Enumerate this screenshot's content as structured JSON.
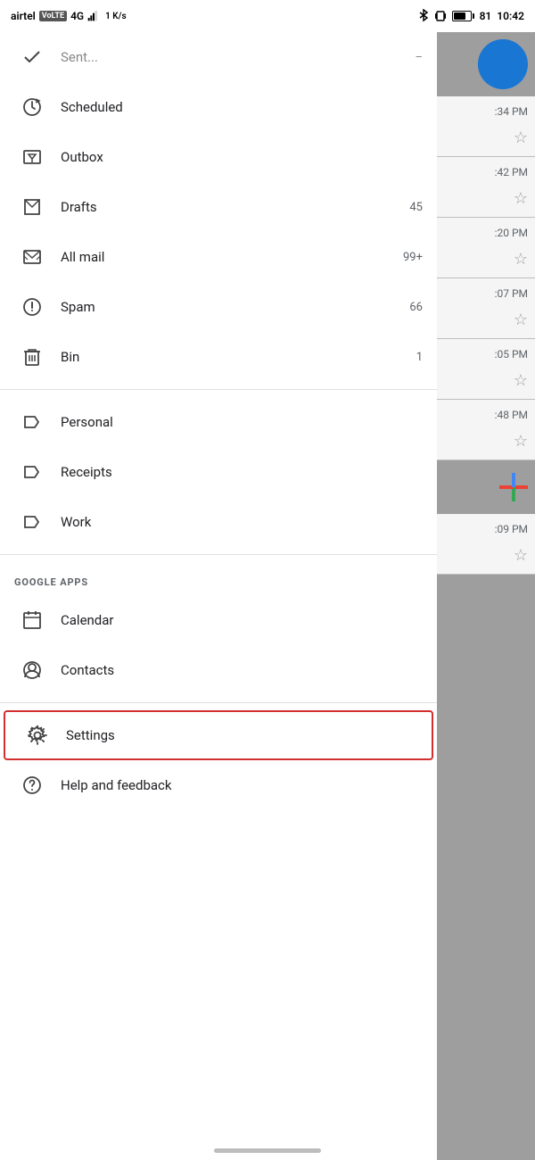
{
  "statusBar": {
    "carrier": "airtel",
    "networkType": "VoLTE",
    "networkGen": "4G",
    "speed": "1 K/s",
    "time": "10:42",
    "batteryPercent": "81"
  },
  "drawer": {
    "topPartial": {
      "label": "Sent",
      "icon": "sent-icon"
    },
    "items": [
      {
        "id": "scheduled",
        "label": "Scheduled",
        "count": "",
        "icon": "scheduled-icon"
      },
      {
        "id": "outbox",
        "label": "Outbox",
        "count": "",
        "icon": "outbox-icon"
      },
      {
        "id": "drafts",
        "label": "Drafts",
        "count": "45",
        "icon": "drafts-icon"
      },
      {
        "id": "all-mail",
        "label": "All mail",
        "count": "99+",
        "icon": "all-mail-icon"
      },
      {
        "id": "spam",
        "label": "Spam",
        "count": "66",
        "icon": "spam-icon"
      },
      {
        "id": "bin",
        "label": "Bin",
        "count": "1",
        "icon": "bin-icon"
      },
      {
        "id": "personal",
        "label": "Personal",
        "count": "",
        "icon": "label-icon"
      },
      {
        "id": "receipts",
        "label": "Receipts",
        "count": "",
        "icon": "label-icon"
      },
      {
        "id": "work",
        "label": "Work",
        "count": "",
        "icon": "label-icon"
      }
    ],
    "googleAppsSection": "GOOGLE APPS",
    "googleApps": [
      {
        "id": "calendar",
        "label": "Calendar",
        "icon": "calendar-icon"
      },
      {
        "id": "contacts",
        "label": "Contacts",
        "icon": "contacts-icon"
      }
    ],
    "bottomItems": [
      {
        "id": "settings",
        "label": "Settings",
        "icon": "settings-icon",
        "highlighted": true
      },
      {
        "id": "help",
        "label": "Help and feedback",
        "icon": "help-icon"
      }
    ]
  },
  "emailPanel": {
    "times": [
      ":34 PM",
      ":42 PM",
      ":20 PM",
      ":07 PM",
      ":05 PM",
      ":48 PM",
      ":09 PM"
    ]
  }
}
